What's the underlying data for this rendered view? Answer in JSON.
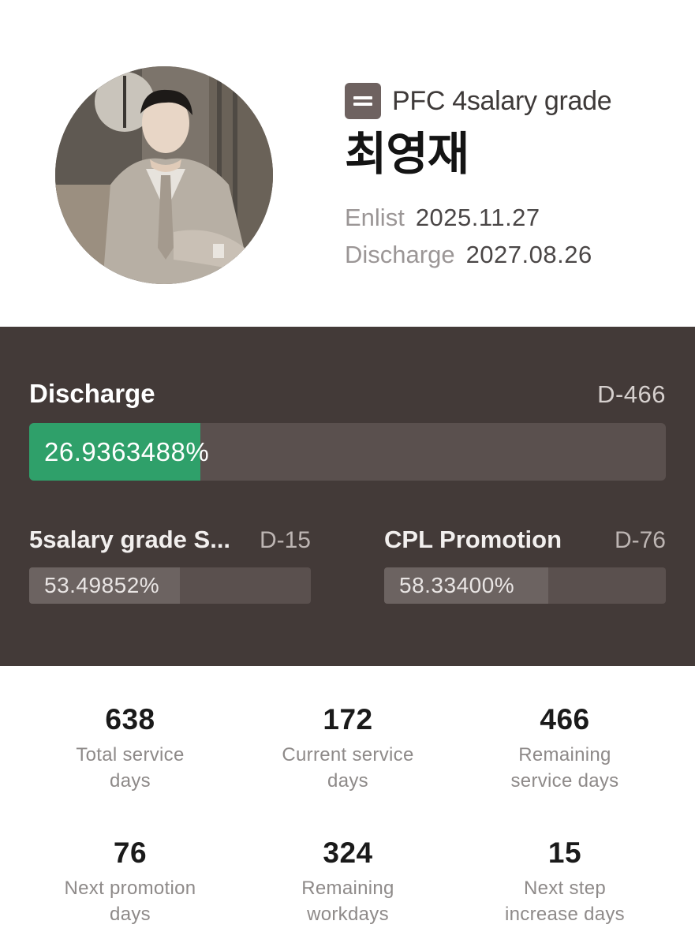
{
  "profile": {
    "rank": "PFC 4salary grade",
    "name": "최영재",
    "enlist_label": "Enlist",
    "enlist_date": "2025.11.27",
    "discharge_label": "Discharge",
    "discharge_date": "2027.08.26",
    "avatar_icon": "profile-photo",
    "rank_icon": "rank-insignia-icon"
  },
  "colors": {
    "panel_bg": "#433a38",
    "progress_green": "#2fa06a",
    "track": "#5a504e",
    "sub_fill": "#6c6361"
  },
  "discharge_progress": {
    "title": "Discharge",
    "dday": "D-466",
    "percent_text": "26.9363488%",
    "fraction": 0.269363488
  },
  "sub_progress": [
    {
      "title": "5salary grade S...",
      "dday": "D-15",
      "percent_text": "53.49852%",
      "fraction": 0.5349852
    },
    {
      "title": "CPL Promotion",
      "dday": "D-76",
      "percent_text": "58.33400%",
      "fraction": 0.58334
    }
  ],
  "stats": [
    {
      "value": "638",
      "label_line1": "Total service",
      "label_line2": "days"
    },
    {
      "value": "172",
      "label_line1": "Current service",
      "label_line2": "days"
    },
    {
      "value": "466",
      "label_line1": "Remaining",
      "label_line2": "service days"
    },
    {
      "value": "76",
      "label_line1": "Next promotion",
      "label_line2": "days"
    },
    {
      "value": "324",
      "label_line1": "Remaining",
      "label_line2": "workdays"
    },
    {
      "value": "15",
      "label_line1": "Next step",
      "label_line2": "increase days"
    }
  ]
}
